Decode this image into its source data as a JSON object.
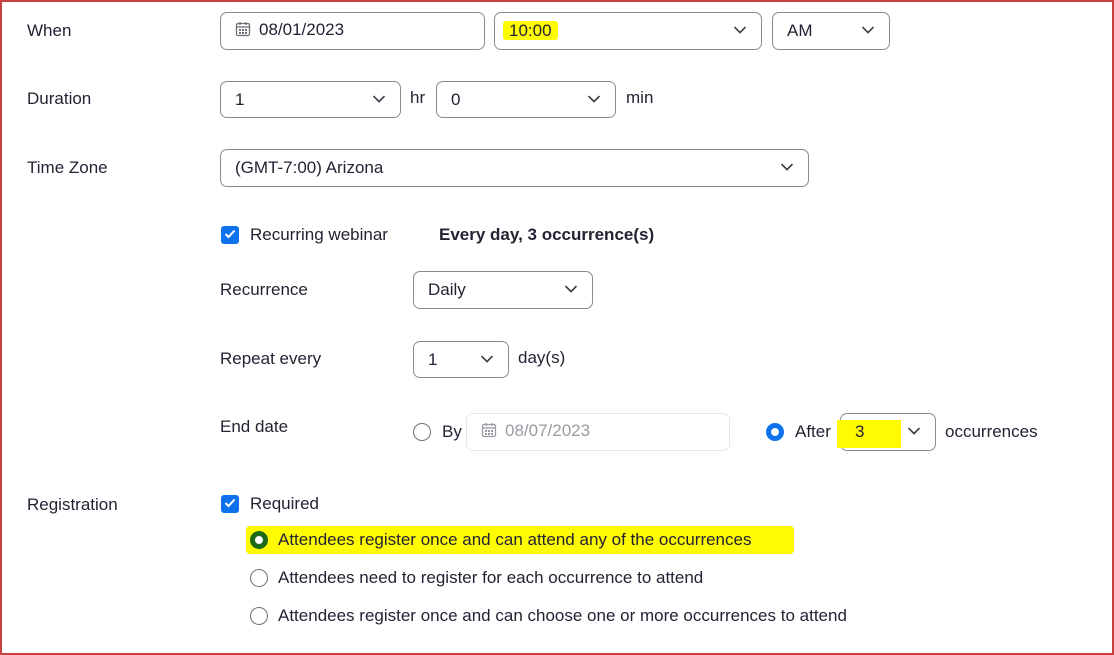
{
  "when": {
    "label": "When",
    "date": "08/01/2023",
    "time": "10:00",
    "ampm": "AM"
  },
  "duration": {
    "label": "Duration",
    "hours": "1",
    "hr_unit": "hr",
    "minutes": "0",
    "min_unit": "min"
  },
  "timezone": {
    "label": "Time Zone",
    "value": "(GMT-7:00) Arizona"
  },
  "recurring": {
    "checkbox_label": "Recurring webinar",
    "summary": "Every day, 3 occurrence(s)",
    "recurrence_label": "Recurrence",
    "recurrence_value": "Daily",
    "repeat_label": "Repeat every",
    "repeat_value": "1",
    "repeat_unit": "day(s)",
    "end_label": "End date",
    "by_label": "By",
    "by_date_placeholder": "08/07/2023",
    "after_label": "After",
    "after_value": "3",
    "after_unit": "occurrences"
  },
  "registration": {
    "label": "Registration",
    "required_label": "Required",
    "options": [
      "Attendees register once and can attend any of the occurrences",
      "Attendees need to register for each occurrence to attend",
      "Attendees register once and can choose one or more occurrences to attend"
    ]
  },
  "colors": {
    "accent": "#0e72ed",
    "highlight": "#fffb00",
    "frame": "#c9413f"
  }
}
